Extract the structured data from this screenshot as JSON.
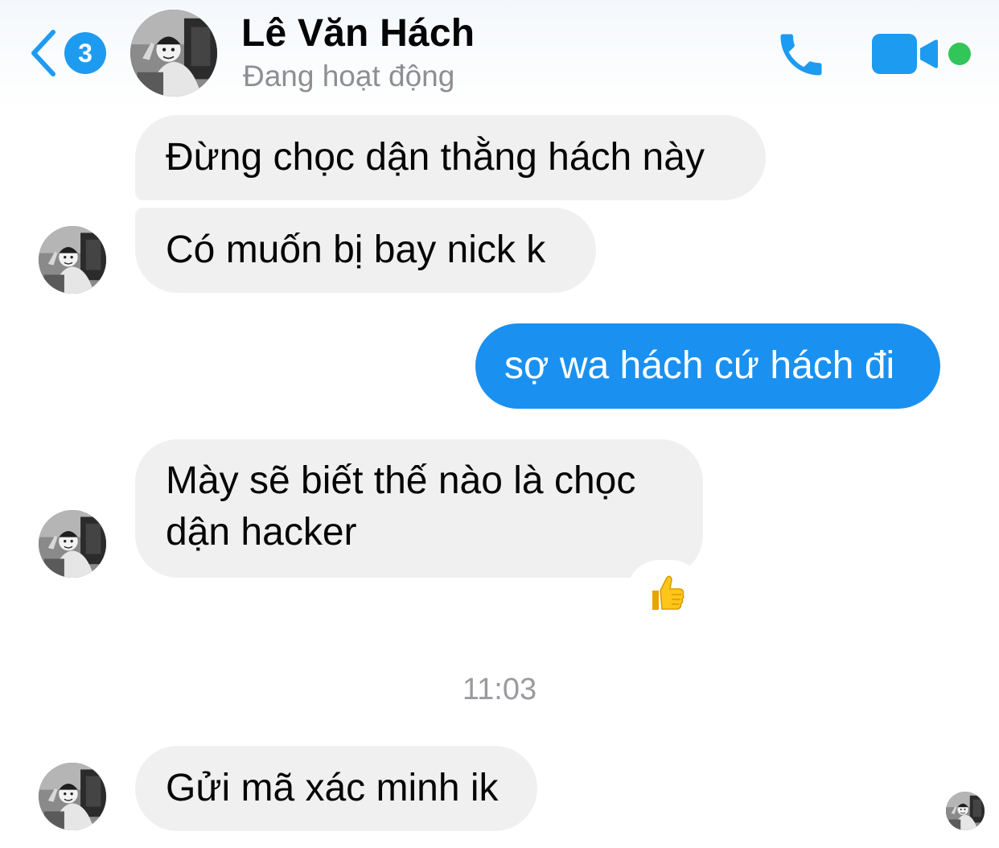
{
  "header": {
    "unread_count": "3",
    "contact_name": "Lê Văn Hách",
    "status": "Đang hoạt động",
    "call_icon": "phone-icon",
    "video_icon": "video-camera-icon",
    "accent_color": "#1d9bf0",
    "online_color": "#31c55a"
  },
  "messages": [
    {
      "direction": "incoming",
      "text": "Đừng chọc dận thằng hách này"
    },
    {
      "direction": "incoming",
      "text": "Có muốn bị bay nick k"
    },
    {
      "direction": "outgoing",
      "text": "sợ wa hách cứ hách đi"
    },
    {
      "direction": "incoming",
      "text": "Mày sẽ biết thế nào là chọc dận hacker",
      "reaction": "thumbs-up"
    },
    {
      "direction": "incoming",
      "text": "Gửi mã xác minh ik"
    }
  ],
  "timestamp": "11:03",
  "colors": {
    "incoming_bubble": "#f0f0f0",
    "outgoing_bubble": "#1a91f0"
  }
}
